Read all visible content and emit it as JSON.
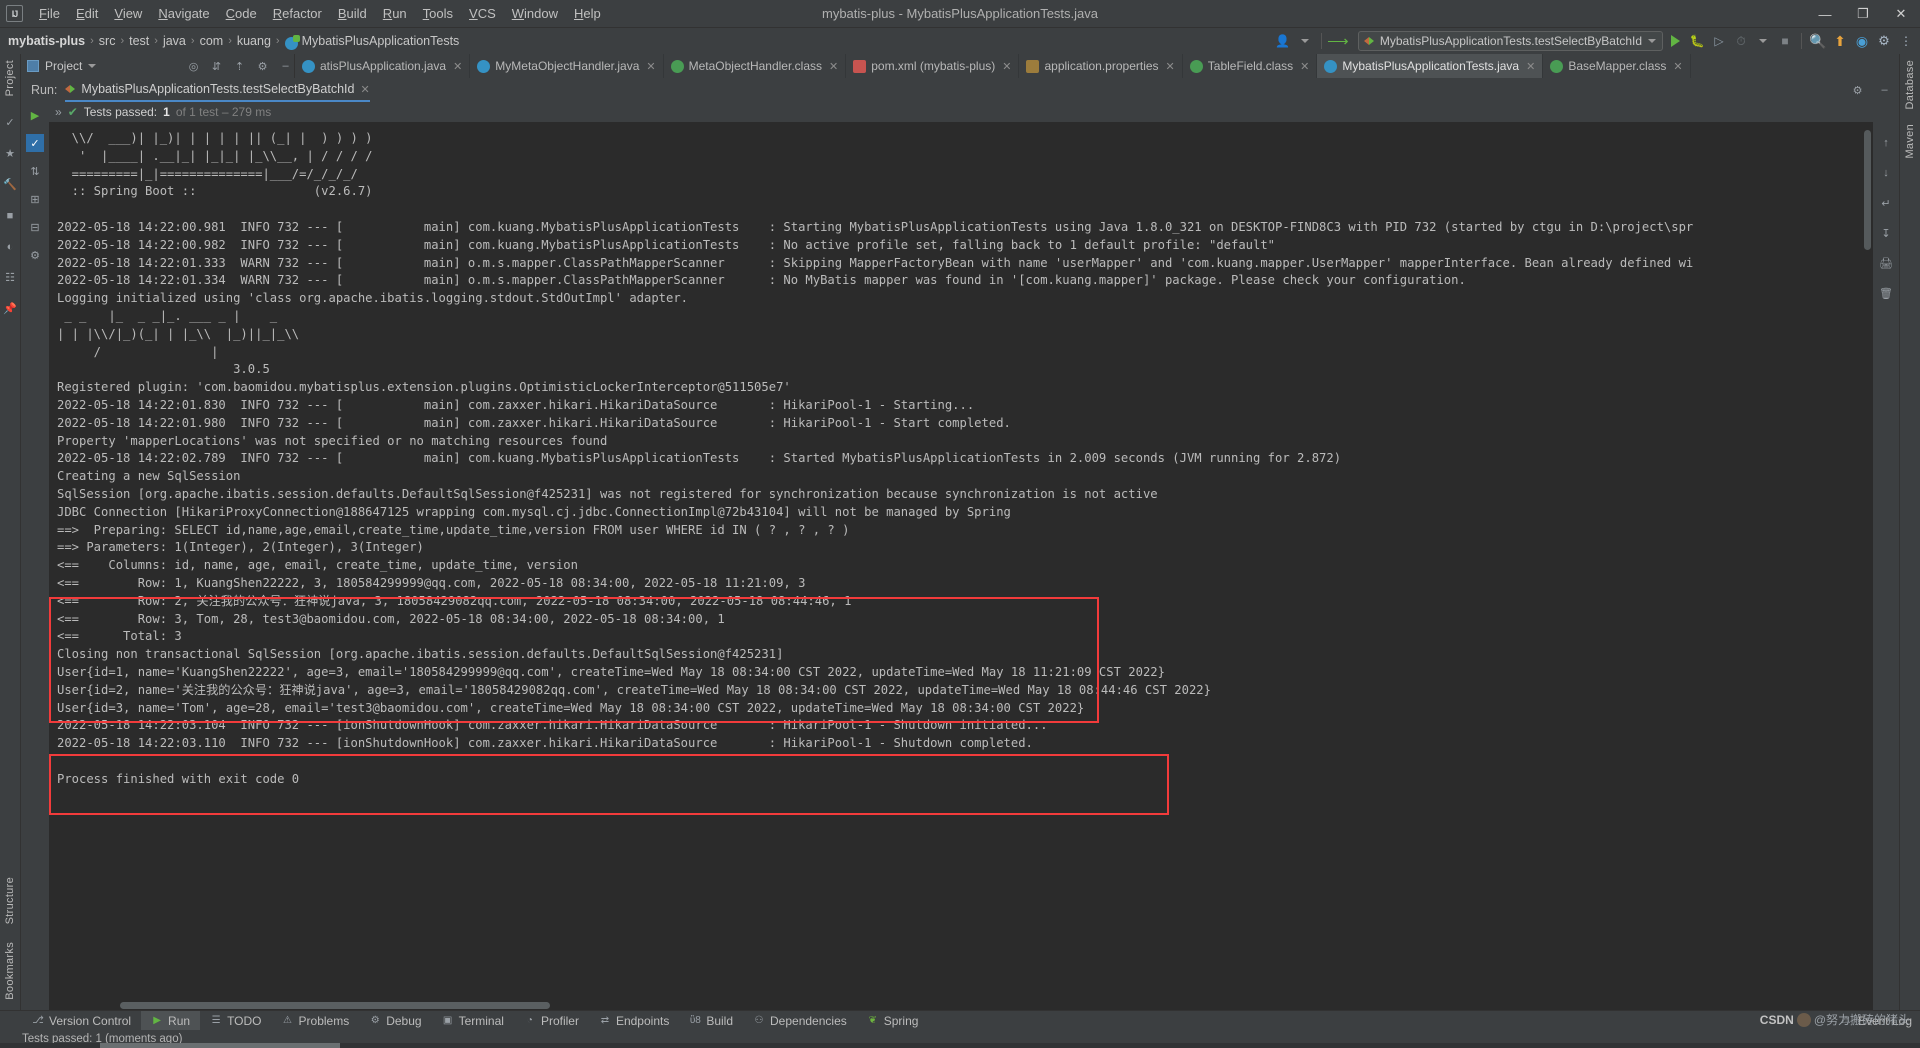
{
  "window": {
    "title": "mybatis-plus - MybatisPlusApplicationTests.java",
    "logo": "IJ",
    "minimize": "—",
    "maximize": "❐",
    "close": "✕"
  },
  "menu": {
    "items": [
      "File",
      "Edit",
      "View",
      "Navigate",
      "Code",
      "Refactor",
      "Build",
      "Run",
      "Tools",
      "VCS",
      "Window",
      "Help"
    ]
  },
  "breadcrumb": {
    "items": [
      "mybatis-plus",
      "src",
      "test",
      "java",
      "com",
      "kuang",
      "MybatisPlusApplicationTests"
    ],
    "separator": "›"
  },
  "toolbar": {
    "run_config": "MybatisPlusApplicationTests.testSelectByBatchId",
    "icons": [
      "avatar-icon",
      "vcs-update-icon",
      "run-icon",
      "debug-icon",
      "run-coverage-icon",
      "profile-icon",
      "stop-icon",
      "search-icon",
      "updates-icon",
      "ai-icon",
      "settings-icon"
    ]
  },
  "project_pane": {
    "label": "Project",
    "icons": [
      "locate-icon",
      "collapse-all-icon",
      "expand-icon",
      "settings-icon",
      "hide-icon"
    ]
  },
  "editor_tabs": [
    {
      "label": "atisPlusApplication.java",
      "icon": "java",
      "active": false
    },
    {
      "label": "MyMetaObjectHandler.java",
      "icon": "java",
      "active": false
    },
    {
      "label": "MetaObjectHandler.class",
      "icon": "cls",
      "active": false
    },
    {
      "label": "pom.xml (mybatis-plus)",
      "icon": "xml",
      "active": false
    },
    {
      "label": "application.properties",
      "icon": "props",
      "active": false
    },
    {
      "label": "TableField.class",
      "icon": "at",
      "active": false
    },
    {
      "label": "MybatisPlusApplicationTests.java",
      "icon": "test",
      "active": true
    },
    {
      "label": "BaseMapper.class",
      "icon": "cls",
      "active": false
    }
  ],
  "run_window": {
    "label": "Run:",
    "tab_title": "MybatisPlusApplicationTests.testSelectByBatchId",
    "status": {
      "prefix": "Tests passed:",
      "count": "1",
      "suffix": "of 1 test – 279 ms"
    }
  },
  "console": {
    "lines": [
      "  \\\\/  ___)| |_)| | | | | || (_| |  ) ) ) )",
      "   '  |____| .__|_| |_|_| |_\\\\__, | / / / /",
      "  =========|_|==============|___/=/_/_/_/",
      "  :: Spring Boot ::                (v2.6.7)",
      "",
      "2022-05-18 14:22:00.981  INFO 732 --- [           main] com.kuang.MybatisPlusApplicationTests    : Starting MybatisPlusApplicationTests using Java 1.8.0_321 on DESKTOP-FIND8C3 with PID 732 (started by ctgu in D:\\project\\spr",
      "2022-05-18 14:22:00.982  INFO 732 --- [           main] com.kuang.MybatisPlusApplicationTests    : No active profile set, falling back to 1 default profile: \"default\"",
      "2022-05-18 14:22:01.333  WARN 732 --- [           main] o.m.s.mapper.ClassPathMapperScanner      : Skipping MapperFactoryBean with name 'userMapper' and 'com.kuang.mapper.UserMapper' mapperInterface. Bean already defined wi",
      "2022-05-18 14:22:01.334  WARN 732 --- [           main] o.m.s.mapper.ClassPathMapperScanner      : No MyBatis mapper was found in '[com.kuang.mapper]' package. Please check your configuration.",
      "Logging initialized using 'class org.apache.ibatis.logging.stdout.StdOutImpl' adapter.",
      " _ _   |_  _ _|_. ___ _ |    _ ",
      "| | |\\\\/|_)(_| | |_\\\\  |_)||_|_\\\\ ",
      "     /               |         ",
      "                        3.0.5 ",
      "Registered plugin: 'com.baomidou.mybatisplus.extension.plugins.OptimisticLockerInterceptor@511505e7'",
      "2022-05-18 14:22:01.830  INFO 732 --- [           main] com.zaxxer.hikari.HikariDataSource       : HikariPool-1 - Starting...",
      "2022-05-18 14:22:01.980  INFO 732 --- [           main] com.zaxxer.hikari.HikariDataSource       : HikariPool-1 - Start completed.",
      "Property 'mapperLocations' was not specified or no matching resources found",
      "2022-05-18 14:22:02.789  INFO 732 --- [           main] com.kuang.MybatisPlusApplicationTests    : Started MybatisPlusApplicationTests in 2.009 seconds (JVM running for 2.872)",
      "Creating a new SqlSession",
      "SqlSession [org.apache.ibatis.session.defaults.DefaultSqlSession@f425231] was not registered for synchronization because synchronization is not active",
      "JDBC Connection [HikariProxyConnection@188647125 wrapping com.mysql.cj.jdbc.ConnectionImpl@72b43104] will not be managed by Spring",
      "==>  Preparing: SELECT id,name,age,email,create_time,update_time,version FROM user WHERE id IN ( ? , ? , ? )",
      "==> Parameters: 1(Integer), 2(Integer), 3(Integer)",
      "<==    Columns: id, name, age, email, create_time, update_time, version",
      "<==        Row: 1, KuangShen22222, 3, 180584299999@qq.com, 2022-05-18 08:34:00, 2022-05-18 11:21:09, 3",
      "<==        Row: 2, 关注我的公众号：狂神说java, 3, 18058429082qq.com, 2022-05-18 08:34:00, 2022-05-18 08:44:46, 1",
      "<==        Row: 3, Tom, 28, test3@baomidou.com, 2022-05-18 08:34:00, 2022-05-18 08:34:00, 1",
      "<==      Total: 3",
      "Closing non transactional SqlSession [org.apache.ibatis.session.defaults.DefaultSqlSession@f425231]",
      "User{id=1, name='KuangShen22222', age=3, email='180584299999@qq.com', createTime=Wed May 18 08:34:00 CST 2022, updateTime=Wed May 18 11:21:09 CST 2022}",
      "User{id=2, name='关注我的公众号：狂神说java', age=3, email='18058429082qq.com', createTime=Wed May 18 08:34:00 CST 2022, updateTime=Wed May 18 08:44:46 CST 2022}",
      "User{id=3, name='Tom', age=28, email='test3@baomidou.com', createTime=Wed May 18 08:34:00 CST 2022, updateTime=Wed May 18 08:34:00 CST 2022}",
      "2022-05-18 14:22:03.104  INFO 732 --- [ionShutdownHook] com.zaxxer.hikari.HikariDataSource       : HikariPool-1 - Shutdown initiated...",
      "2022-05-18 14:22:03.110  INFO 732 --- [ionShutdownHook] com.zaxxer.hikari.HikariDataSource       : HikariPool-1 - Shutdown completed.",
      "",
      "Process finished with exit code 0"
    ],
    "highlight_color": "#f23b3b"
  },
  "left_strip": {
    "labels": [
      "Project",
      "Structure",
      "Bookmarks"
    ]
  },
  "right_strip": {
    "labels": [
      "Database",
      "Maven"
    ]
  },
  "bottom_bar": {
    "items": [
      {
        "label": "Version Control",
        "icon": "branch-icon",
        "active": false
      },
      {
        "label": "Run",
        "icon": "run-icon",
        "active": true
      },
      {
        "label": "TODO",
        "icon": "todo-icon",
        "active": false
      },
      {
        "label": "Problems",
        "icon": "problems-icon",
        "active": false
      },
      {
        "label": "Debug",
        "icon": "debug-icon",
        "active": false
      },
      {
        "label": "Terminal",
        "icon": "terminal-icon",
        "active": false
      },
      {
        "label": "Profiler",
        "icon": "profiler-icon",
        "active": false
      },
      {
        "label": "Endpoints",
        "icon": "endpoints-icon",
        "active": false
      },
      {
        "label": "Build",
        "icon": "build-icon",
        "active": false
      },
      {
        "label": "Dependencies",
        "icon": "dependencies-icon",
        "active": false
      },
      {
        "label": "Spring",
        "icon": "spring-icon",
        "active": false
      }
    ],
    "event_log": "Event Log"
  },
  "status_bar": {
    "text": "Tests passed: 1 (moments ago)"
  },
  "watermark": {
    "prefix": "CSDN",
    "suffix": "@努力搬砖的猪头"
  }
}
